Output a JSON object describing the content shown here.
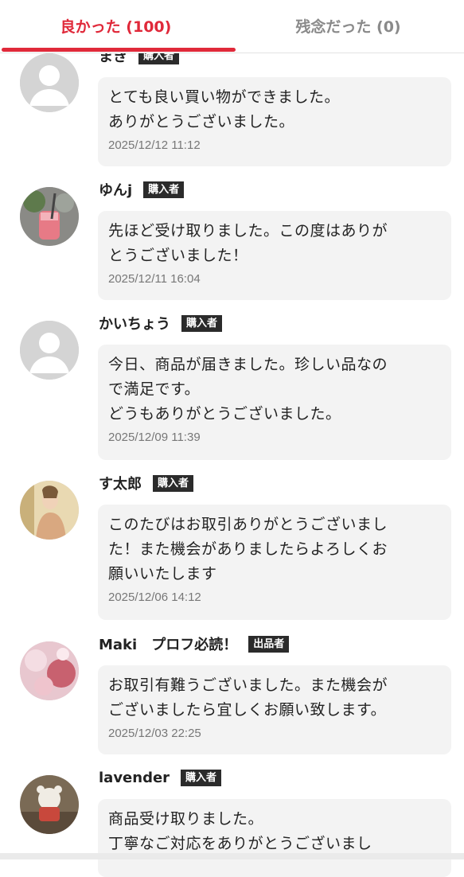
{
  "tabs": {
    "good": "良かった (100)",
    "bad": "残念だった (0)"
  },
  "reviews": [
    {
      "name": "まき",
      "badge": "購入者",
      "avatar_icon": "default-user-icon",
      "message": "とても良い買い物ができました。\nありがとうございました。",
      "date": "2025/12/12 11:12"
    },
    {
      "name": "ゆんj",
      "badge": "購入者",
      "avatar_icon": "drink-photo-icon",
      "message": "先ほど受け取りました。この度はありが\nとうございました！",
      "date": "2025/12/11 16:04"
    },
    {
      "name": "かいちょう",
      "badge": "購入者",
      "avatar_icon": "default-user-icon",
      "message": "今日、商品が届きました。珍しい品なの\nで満足です。\nどうもありがとうございました。",
      "date": "2025/12/09 11:39"
    },
    {
      "name": "す太郎",
      "badge": "購入者",
      "avatar_icon": "portrait-photo-icon",
      "message": "このたびはお取引ありがとうございまし\nた！また機会がありましたらよろしくお\n願いいたします",
      "date": "2025/12/06 14:12"
    },
    {
      "name": "Maki　プロフ必読！",
      "badge": "出品者",
      "avatar_icon": "pink-flower-photo-icon",
      "message": "お取引有難うございました。また機会が\nございましたら宜しくお願い致します。",
      "date": "2025/12/03 22:25"
    },
    {
      "name": "lavender",
      "badge": "購入者",
      "avatar_icon": "bear-figure-photo-icon",
      "message": "商品受け取りました。\n丁寧なご対応をありがとうございまし",
      "date": ""
    }
  ]
}
